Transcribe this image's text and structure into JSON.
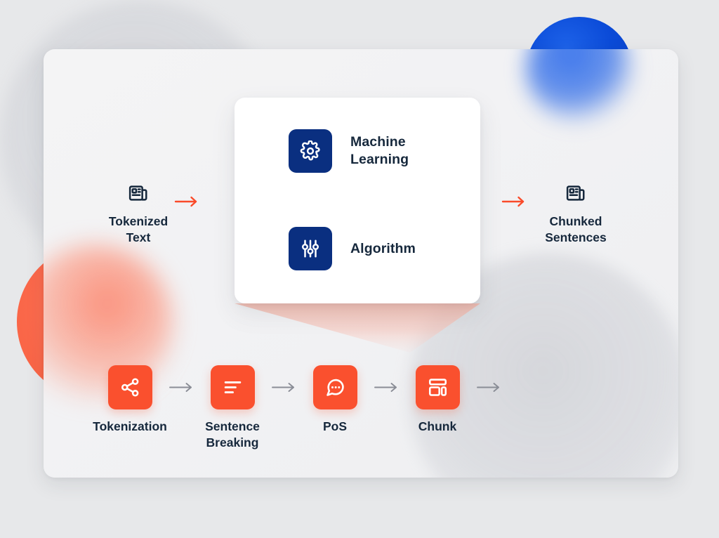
{
  "diagram": {
    "title": "NLP chunking pipeline diagram",
    "colors": {
      "background": "#e7e8ea",
      "panel": "#f2f2f4",
      "card": "#ffffff",
      "navy_tile": "#0a2f80",
      "orange_tile": "#fa502e",
      "orange_arrow": "#fa4b2a",
      "gray_arrow": "#8a8d96",
      "text": "#16283c",
      "blob_blue": "#0b4bd8",
      "blob_coral": "#fb6a4d",
      "blob_gray": "#c6c8cf"
    }
  },
  "endpoints": {
    "input": {
      "label": "Tokenized\nText",
      "icon": "article-newspaper-icon"
    },
    "output": {
      "label": "Chunked\nSentences",
      "icon": "article-newspaper-icon"
    }
  },
  "arrows": {
    "input_arrow": "arrow-right-orange-icon",
    "output_arrow": "arrow-right-orange-icon",
    "step_arrow": "arrow-right-gray-icon"
  },
  "card": {
    "items": [
      {
        "label": "Machine\nLearning",
        "icon": "gear-settings-icon"
      },
      {
        "label": "Algorithm",
        "icon": "sliders-equalizer-icon"
      }
    ]
  },
  "pipeline": {
    "steps": [
      {
        "label": "Tokenization",
        "icon": "share-nodes-icon"
      },
      {
        "label": "Sentence\nBreaking",
        "icon": "text-lines-icon"
      },
      {
        "label": "PoS",
        "icon": "speech-bubble-dots-icon"
      },
      {
        "label": "Chunk",
        "icon": "layout-blocks-icon"
      }
    ]
  }
}
